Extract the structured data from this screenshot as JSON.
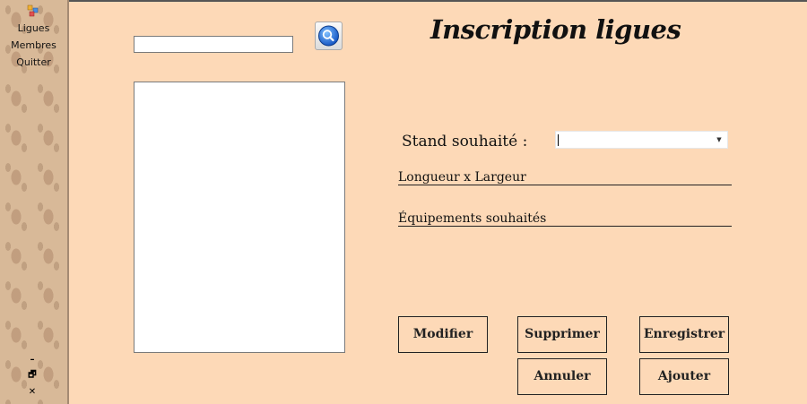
{
  "sidebar": {
    "menu": [
      {
        "label": "Ligues"
      },
      {
        "label": "Membres"
      },
      {
        "label": "Quitter"
      }
    ],
    "window_controls": {
      "minimize": "–",
      "restore": "🗗",
      "close": "✕"
    }
  },
  "search": {
    "value": "",
    "placeholder": "",
    "button_icon": "magnifier-icon"
  },
  "form": {
    "title": "Inscription ligues",
    "stand_label": "Stand souhaité :",
    "stand_value": "",
    "dimensions_label": "Longueur x Largeur",
    "equipment_label": "Équipements souhaités"
  },
  "buttons": {
    "modifier": "Modifier",
    "supprimer": "Supprimer",
    "enregistrer": "Enregistrer",
    "annuler": "Annuler",
    "ajouter": "Ajouter"
  },
  "colors": {
    "background": "#fdd9b7",
    "search_icon": "#1e6fd9"
  }
}
